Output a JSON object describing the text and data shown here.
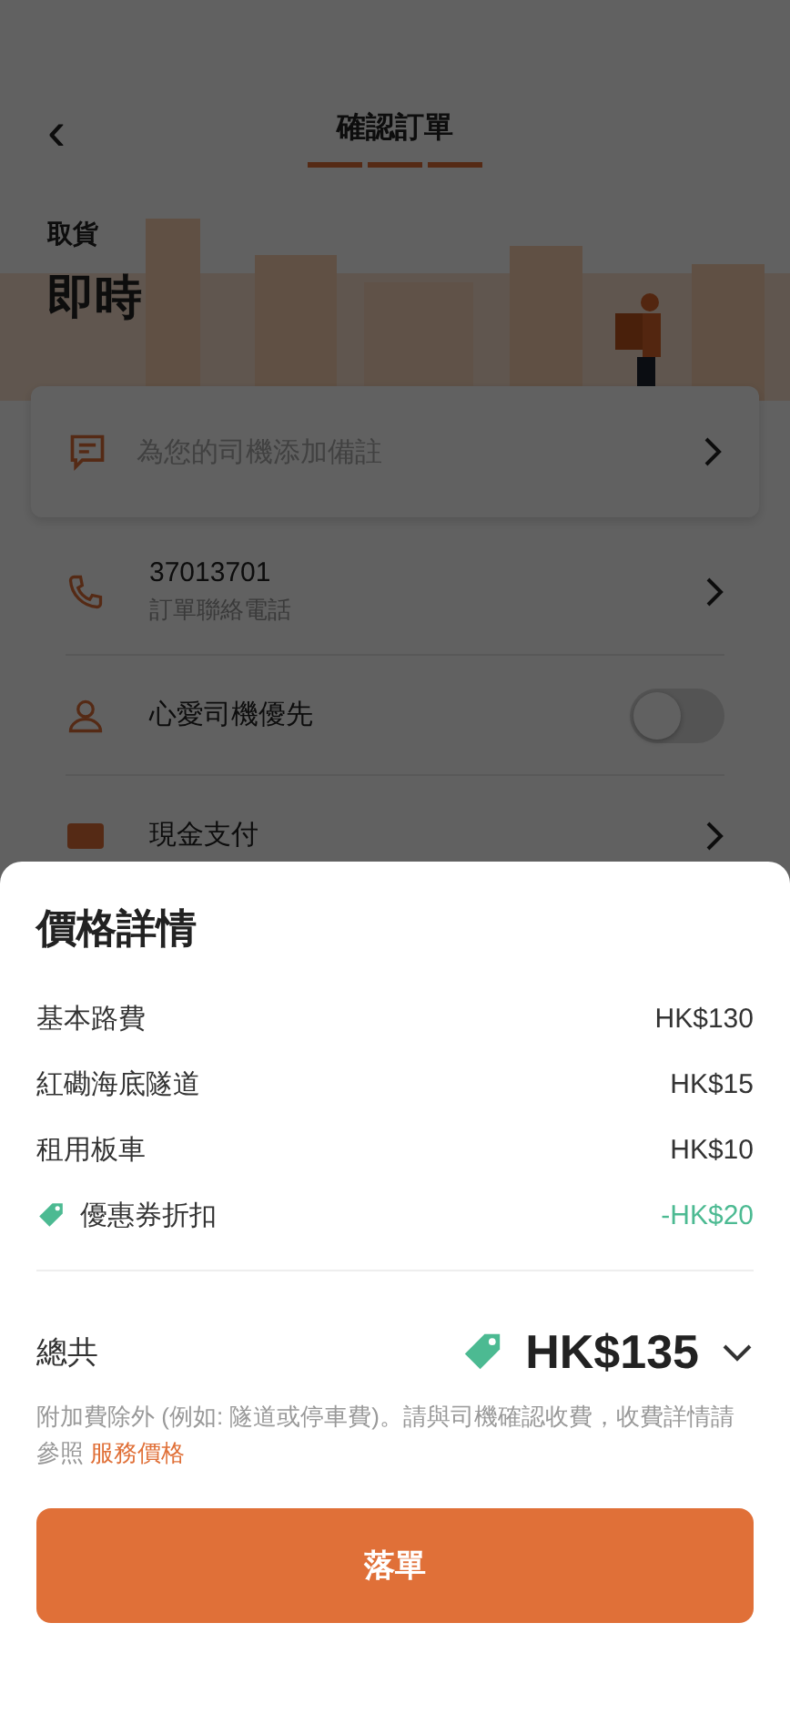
{
  "header": {
    "title": "確認訂單",
    "back": "‹"
  },
  "pickup": {
    "label": "取貨",
    "time": "即時"
  },
  "note_card": {
    "placeholder": "為您的司機添加備註"
  },
  "rows": [
    {
      "kind": "phone",
      "title": "37013701",
      "subtitle": "訂單聯絡電話"
    },
    {
      "kind": "favorite",
      "title": "心愛司機優先",
      "on": false
    },
    {
      "kind": "payment",
      "title": "現金支付"
    }
  ],
  "price_sheet": {
    "title": "價格詳情",
    "items": [
      {
        "kind": "fee",
        "label": "基本路費",
        "amount": "HK$130"
      },
      {
        "kind": "fee",
        "label": "紅磡海底隧道",
        "amount": "HK$15"
      },
      {
        "kind": "fee",
        "label": "租用板車",
        "amount": "HK$10"
      },
      {
        "kind": "discount",
        "label": "優惠券折扣",
        "amount": "-HK$20"
      }
    ],
    "total_label": "總共",
    "total": "HK$135",
    "note": "附加費除外 (例如: 隧道或停車費)。請與司機確認收費，收費詳情請參照",
    "note_link": "服務價格",
    "submit": "落單"
  }
}
